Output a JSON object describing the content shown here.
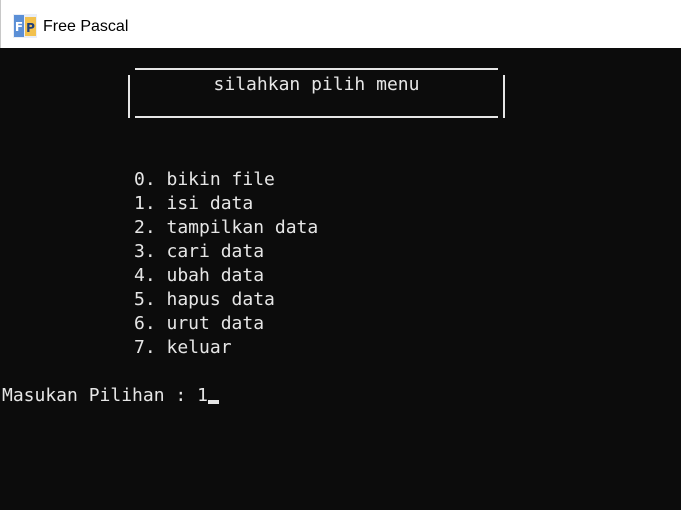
{
  "window": {
    "title": "Free Pascal",
    "icon": "free-pascal-app-icon"
  },
  "console": {
    "header": "silahkan pilih menu",
    "menu_items": [
      "0. bikin file",
      "1. isi data",
      "2. tampilkan data",
      "3. cari data",
      "4. ubah data",
      "5. hapus data",
      "6. urut data",
      "7. keluar"
    ],
    "prompt": "Masukan Pilihan : ",
    "input_value": "1"
  },
  "colors": {
    "console_background": "#0c0c0c",
    "console_text": "#e6e6e6",
    "titlebar_background": "#ffffff"
  }
}
